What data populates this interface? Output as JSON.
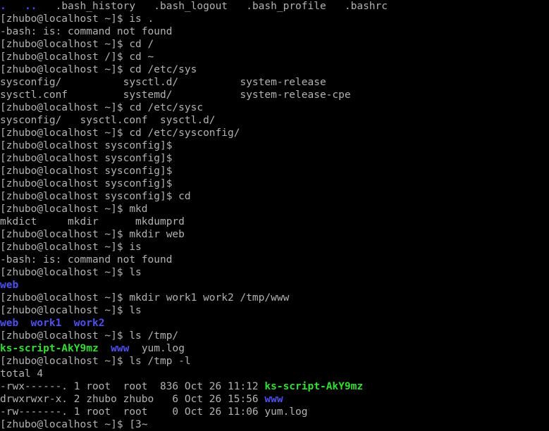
{
  "window": {
    "app": "terminal-emulator",
    "title": "zhubo@localhost:~",
    "columns": 97,
    "rows": 31
  },
  "theme": {
    "background": "#000000",
    "foreground": "#b2b2b2",
    "dir_blue": "#5050f0",
    "exec_green": "#33dd33"
  },
  "shell": {
    "user": "zhubo",
    "host": "localhost",
    "prompt_symbol": "$"
  },
  "lines": [
    {
      "id": "line-0",
      "kind": "ls-output",
      "segments": [
        {
          "text": ".",
          "color": "blue"
        },
        {
          "text": "   ",
          "color": "default"
        },
        {
          "text": "..",
          "color": "blue"
        },
        {
          "text": "   .bash_history   .bash_logout   .bash_profile   .bashrc",
          "color": "default"
        }
      ]
    },
    {
      "id": "line-1",
      "kind": "prompt-command",
      "segments": [
        {
          "text": "[zhubo@localhost ~]$ is .",
          "color": "default"
        }
      ]
    },
    {
      "id": "line-2",
      "kind": "error",
      "segments": [
        {
          "text": "-bash: is: command not found",
          "color": "default"
        }
      ]
    },
    {
      "id": "line-3",
      "kind": "prompt-command",
      "segments": [
        {
          "text": "[zhubo@localhost ~]$ cd /",
          "color": "default"
        }
      ]
    },
    {
      "id": "line-4",
      "kind": "prompt-command",
      "segments": [
        {
          "text": "[zhubo@localhost /]$ cd ~",
          "color": "default"
        }
      ]
    },
    {
      "id": "line-5",
      "kind": "prompt-command",
      "segments": [
        {
          "text": "[zhubo@localhost ~]$ cd /etc/sys",
          "color": "default"
        }
      ]
    },
    {
      "id": "line-6",
      "kind": "completion-output",
      "segments": [
        {
          "text": "sysconfig/          sysctl.d/          system-release",
          "color": "default"
        }
      ]
    },
    {
      "id": "line-7",
      "kind": "completion-output",
      "segments": [
        {
          "text": "sysctl.conf         systemd/           system-release-cpe",
          "color": "default"
        }
      ]
    },
    {
      "id": "line-8",
      "kind": "prompt-command",
      "segments": [
        {
          "text": "[zhubo@localhost ~]$ cd /etc/sysc",
          "color": "default"
        }
      ]
    },
    {
      "id": "line-9",
      "kind": "completion-output",
      "segments": [
        {
          "text": "sysconfig/   sysctl.conf  sysctl.d/",
          "color": "default"
        }
      ]
    },
    {
      "id": "line-10",
      "kind": "prompt-command",
      "segments": [
        {
          "text": "[zhubo@localhost ~]$ cd /etc/sysconfig/",
          "color": "default"
        }
      ]
    },
    {
      "id": "line-11",
      "kind": "prompt-command",
      "segments": [
        {
          "text": "[zhubo@localhost sysconfig]$",
          "color": "default"
        }
      ]
    },
    {
      "id": "line-12",
      "kind": "prompt-command",
      "segments": [
        {
          "text": "[zhubo@localhost sysconfig]$",
          "color": "default"
        }
      ]
    },
    {
      "id": "line-13",
      "kind": "prompt-command",
      "segments": [
        {
          "text": "[zhubo@localhost sysconfig]$",
          "color": "default"
        }
      ]
    },
    {
      "id": "line-14",
      "kind": "prompt-command",
      "segments": [
        {
          "text": "[zhubo@localhost sysconfig]$",
          "color": "default"
        }
      ]
    },
    {
      "id": "line-15",
      "kind": "prompt-command",
      "segments": [
        {
          "text": "[zhubo@localhost sysconfig]$ cd",
          "color": "default"
        }
      ]
    },
    {
      "id": "line-16",
      "kind": "prompt-command",
      "segments": [
        {
          "text": "[zhubo@localhost ~]$ mkd",
          "color": "default"
        }
      ]
    },
    {
      "id": "line-17",
      "kind": "completion-output",
      "segments": [
        {
          "text": "mkdict     mkdir      mkdumprd",
          "color": "default"
        }
      ]
    },
    {
      "id": "line-18",
      "kind": "prompt-command",
      "segments": [
        {
          "text": "[zhubo@localhost ~]$ mkdir web",
          "color": "default"
        }
      ]
    },
    {
      "id": "line-19",
      "kind": "prompt-command",
      "segments": [
        {
          "text": "[zhubo@localhost ~]$ is",
          "color": "default"
        }
      ]
    },
    {
      "id": "line-20",
      "kind": "error",
      "segments": [
        {
          "text": "-bash: is: command not found",
          "color": "default"
        }
      ]
    },
    {
      "id": "line-21",
      "kind": "prompt-command",
      "segments": [
        {
          "text": "[zhubo@localhost ~]$ ls",
          "color": "default"
        }
      ]
    },
    {
      "id": "line-22",
      "kind": "ls-output",
      "segments": [
        {
          "text": "web",
          "color": "blue"
        }
      ]
    },
    {
      "id": "line-23",
      "kind": "prompt-command",
      "segments": [
        {
          "text": "[zhubo@localhost ~]$ mkdir work1 work2 /tmp/www",
          "color": "default"
        }
      ]
    },
    {
      "id": "line-24",
      "kind": "prompt-command",
      "segments": [
        {
          "text": "[zhubo@localhost ~]$ ls",
          "color": "default"
        }
      ]
    },
    {
      "id": "line-25",
      "kind": "ls-output",
      "segments": [
        {
          "text": "web",
          "color": "blue"
        },
        {
          "text": "  ",
          "color": "default"
        },
        {
          "text": "work1",
          "color": "blue"
        },
        {
          "text": "  ",
          "color": "default"
        },
        {
          "text": "work2",
          "color": "blue"
        }
      ]
    },
    {
      "id": "line-26",
      "kind": "prompt-command",
      "segments": [
        {
          "text": "[zhubo@localhost ~]$ ls /tmp/",
          "color": "default"
        }
      ]
    },
    {
      "id": "line-27",
      "kind": "ls-output",
      "segments": [
        {
          "text": "ks-script-AkY9mz",
          "color": "green"
        },
        {
          "text": "  ",
          "color": "default"
        },
        {
          "text": "www",
          "color": "blue"
        },
        {
          "text": "  yum.log",
          "color": "default"
        }
      ]
    },
    {
      "id": "line-28",
      "kind": "prompt-command",
      "segments": [
        {
          "text": "[zhubo@localhost ~]$ ls /tmp -l",
          "color": "default"
        }
      ]
    },
    {
      "id": "line-29",
      "kind": "ls-long-header",
      "segments": [
        {
          "text": "total 4",
          "color": "default"
        }
      ]
    },
    {
      "id": "line-30",
      "kind": "ls-long-entry",
      "segments": [
        {
          "text": "-rwx------. 1 root  root  836 Oct 26 11:12 ",
          "color": "default"
        },
        {
          "text": "ks-script-AkY9mz",
          "color": "green"
        }
      ]
    },
    {
      "id": "line-31",
      "kind": "ls-long-entry",
      "segments": [
        {
          "text": "drwxrwxr-x. 2 zhubo zhubo   6 Oct 26 15:56 ",
          "color": "default"
        },
        {
          "text": "www",
          "color": "blue"
        }
      ]
    },
    {
      "id": "line-32",
      "kind": "ls-long-entry",
      "segments": [
        {
          "text": "-rw-------. 1 root  root    0 Oct 26 11:06 yum.log",
          "color": "default"
        }
      ]
    },
    {
      "id": "line-33",
      "kind": "prompt-current",
      "segments": [
        {
          "text": "[zhubo@localhost ~]$ [3~",
          "color": "default"
        }
      ]
    }
  ]
}
